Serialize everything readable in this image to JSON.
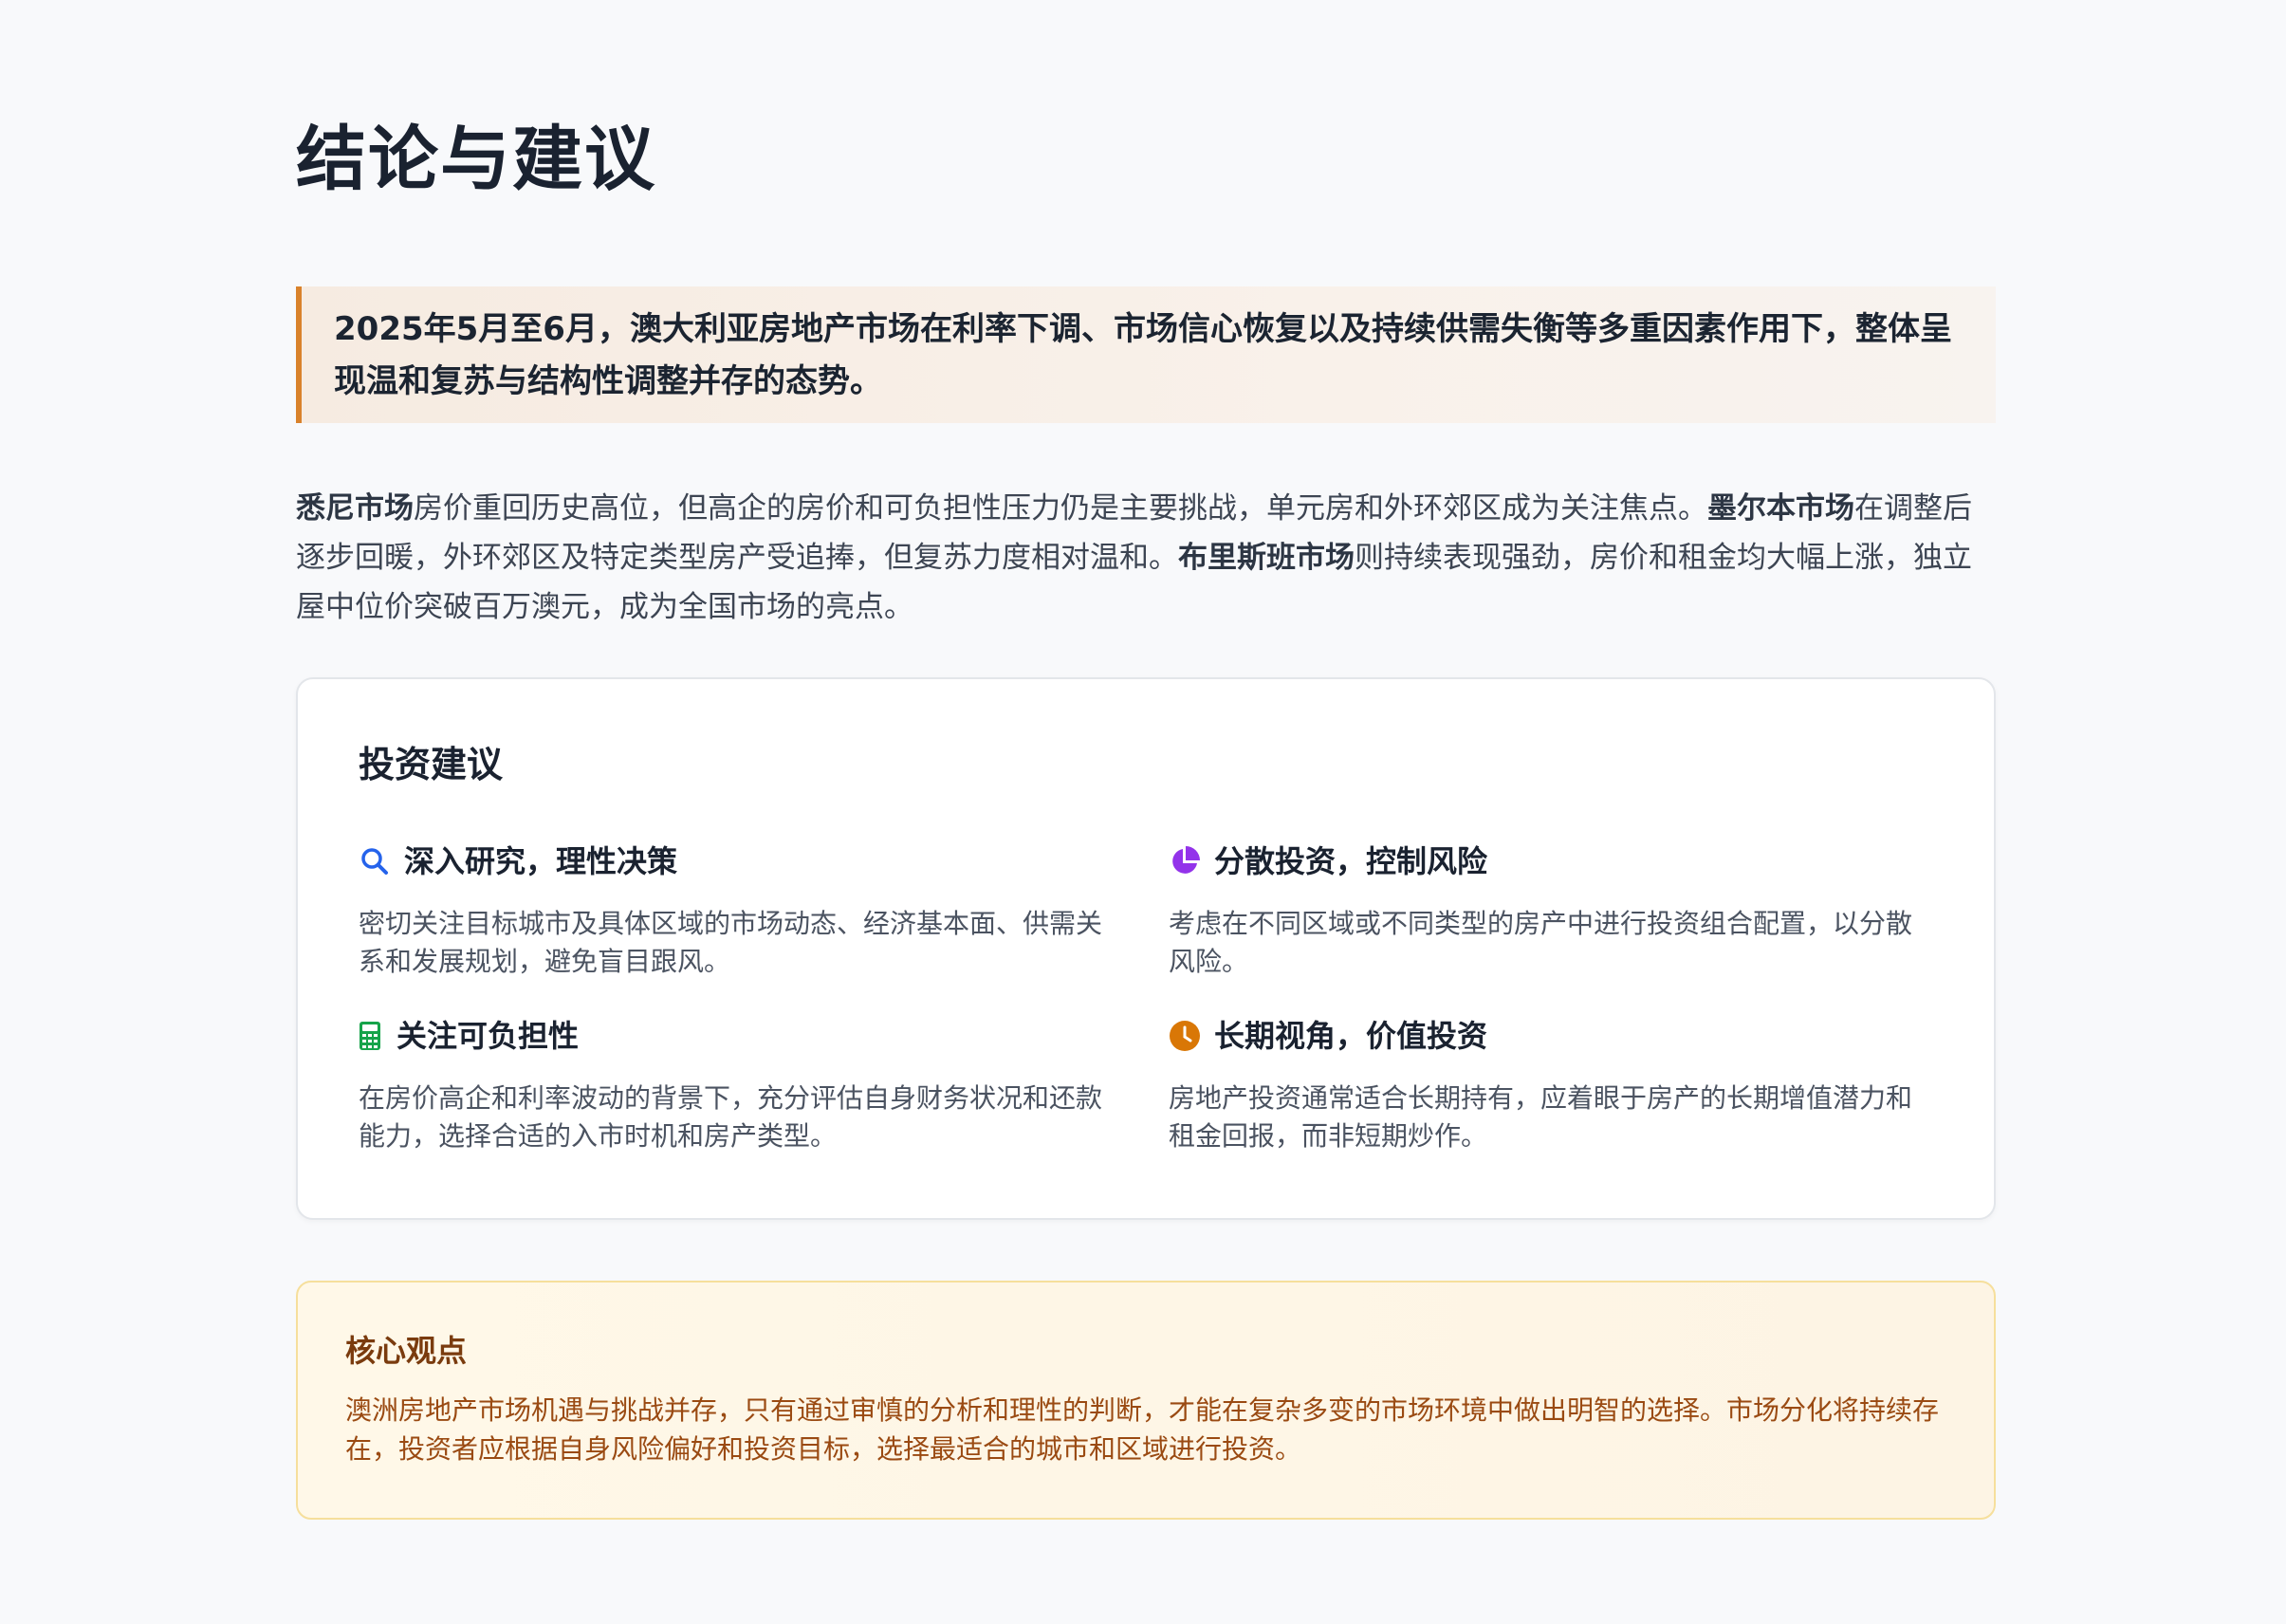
{
  "page": {
    "title": "结论与建议"
  },
  "lead": {
    "text": "2025年5月至6月，澳大利亚房地产市场在利率下调、市场信心恢复以及持续供需失衡等多重因素作用下，整体呈现温和复苏与结构性调整并存的态势。"
  },
  "summary": {
    "sydney_label": "悉尼市场",
    "sydney_text": "房价重回历史高位，但高企的房价和可负担性压力仍是主要挑战，单元房和外环郊区成为关注焦点。",
    "melbourne_label": "墨尔本市场",
    "melbourne_text": "在调整后逐步回暖，外环郊区及特定类型房产受追捧，但复苏力度相对温和。",
    "brisbane_label": "布里斯班市场",
    "brisbane_text": "则持续表现强劲，房价和租金均大幅上涨，独立屋中位价突破百万澳元，成为全国市场的亮点。"
  },
  "advice": {
    "title": "投资建议",
    "items": [
      {
        "icon": "search-icon",
        "icon_color": "#2563eb",
        "heading": "深入研究，理性决策",
        "text": "密切关注目标城市及具体区域的市场动态、经济基本面、供需关系和发展规划，避免盲目跟风。"
      },
      {
        "icon": "pie-chart-icon",
        "icon_color": "#9333ea",
        "heading": "分散投资，控制风险",
        "text": "考虑在不同区域或不同类型的房产中进行投资组合配置，以分散风险。"
      },
      {
        "icon": "calculator-icon",
        "icon_color": "#16a34a",
        "heading": "关注可负担性",
        "text": "在房价高企和利率波动的背景下，充分评估自身财务状况和还款能力，选择合适的入市时机和房产类型。"
      },
      {
        "icon": "clock-icon",
        "icon_color": "#d97706",
        "heading": "长期视角，价值投资",
        "text": "房地产投资通常适合长期持有，应着眼于房产的长期增值潜力和租金回报，而非短期炒作。"
      }
    ]
  },
  "core": {
    "title": "核心观点",
    "text": "澳洲房地产市场机遇与挑战并存，只有通过审慎的分析和理性的判断，才能在复杂多变的市场环境中做出明智的选择。市场分化将持续存在，投资者应根据自身风险偏好和投资目标，选择最适合的城市和区域进行投资。"
  },
  "colors": {
    "accent_border": "#d9822b",
    "core_title": "#7a3b0e",
    "core_text": "#9a4a12"
  }
}
